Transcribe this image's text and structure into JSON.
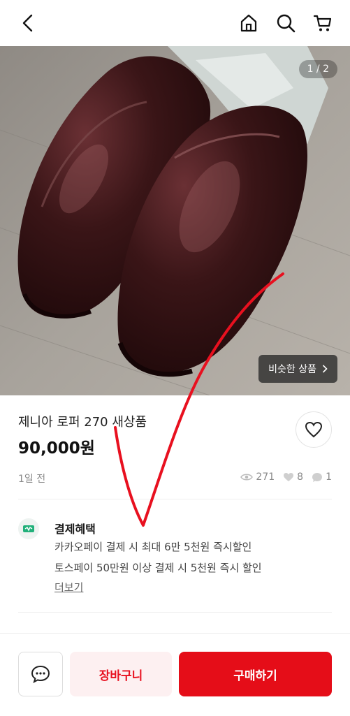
{
  "photo": {
    "counter": "1 / 2",
    "similar_label": "비슷한 상품"
  },
  "product": {
    "title": "제니아 로퍼 270 새상품",
    "price": "90,000원",
    "posted": "1일 전",
    "views": "271",
    "likes": "8",
    "chats": "1"
  },
  "benefit": {
    "title": "결제혜택",
    "lines": [
      "카카오페이 결제 시 최대 6만 5천원 즉시할인",
      "토스페이 50만원 이상 결제 시 5천원 즉시 할인"
    ],
    "more": "더보기"
  },
  "bottom": {
    "cart_label": "장바구니",
    "buy_label": "구매하기"
  },
  "colors": {
    "accent": "#e50d18",
    "cart_bg": "#fdf0f1",
    "benefit_icon": "#21b07a"
  },
  "icons": {
    "back": "back-arrow-icon",
    "home": "home-icon",
    "search": "search-icon",
    "cart": "cart-icon",
    "chevron": "chevron-right-icon",
    "heart": "heart-icon",
    "view": "eye-icon",
    "like": "heart-icon",
    "chat": "chat-bubble-icon"
  }
}
